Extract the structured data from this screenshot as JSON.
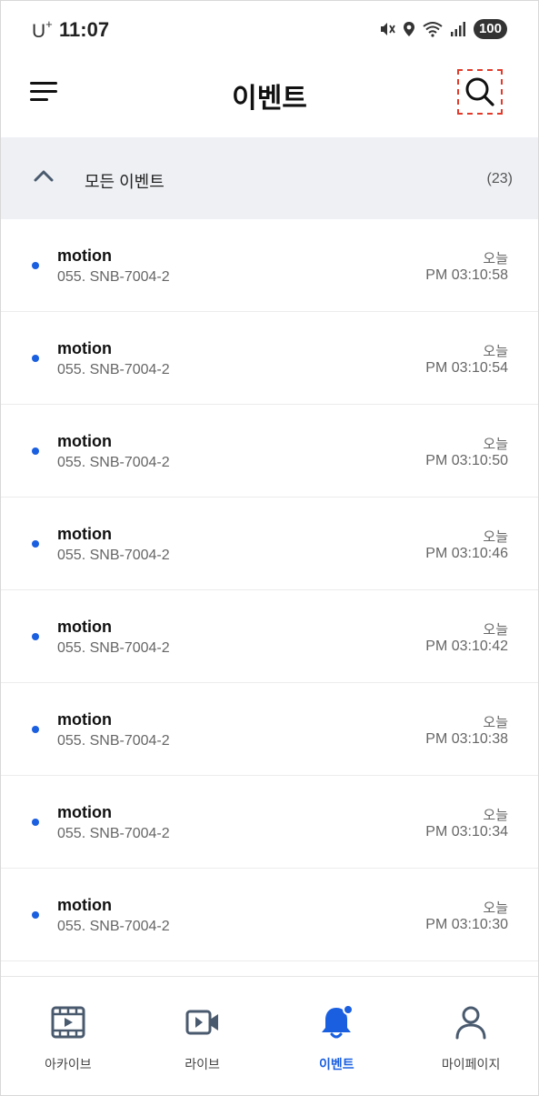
{
  "status_bar": {
    "carrier": "U",
    "carrier_sup": "+",
    "time": "11:07",
    "battery": "100"
  },
  "header": {
    "title": "이벤트",
    "menu_icon": "menu-icon",
    "search_icon": "search-icon"
  },
  "group": {
    "title": "모든 이벤트",
    "count": "(23)",
    "expanded": true
  },
  "events": [
    {
      "title": "motion",
      "camera": "055. SNB-7004-2",
      "day": "오늘",
      "time": "PM 03:10:58"
    },
    {
      "title": "motion",
      "camera": "055. SNB-7004-2",
      "day": "오늘",
      "time": "PM 03:10:54"
    },
    {
      "title": "motion",
      "camera": "055. SNB-7004-2",
      "day": "오늘",
      "time": "PM 03:10:50"
    },
    {
      "title": "motion",
      "camera": "055. SNB-7004-2",
      "day": "오늘",
      "time": "PM 03:10:46"
    },
    {
      "title": "motion",
      "camera": "055. SNB-7004-2",
      "day": "오늘",
      "time": "PM 03:10:42"
    },
    {
      "title": "motion",
      "camera": "055. SNB-7004-2",
      "day": "오늘",
      "time": "PM 03:10:38"
    },
    {
      "title": "motion",
      "camera": "055. SNB-7004-2",
      "day": "오늘",
      "time": "PM 03:10:34"
    },
    {
      "title": "motion",
      "camera": "055. SNB-7004-2",
      "day": "오늘",
      "time": "PM 03:10:30"
    }
  ],
  "bottom_nav": {
    "items": [
      {
        "label": "아카이브",
        "icon": "film-play-icon"
      },
      {
        "label": "라이브",
        "icon": "video-camera-icon"
      },
      {
        "label": "이벤트",
        "icon": "bell-icon",
        "active": true
      },
      {
        "label": "마이페이지",
        "icon": "user-icon"
      }
    ]
  },
  "colors": {
    "accent": "#1a5fe0",
    "group_bg": "#eef0f4",
    "icon_gray": "#4a5a6e"
  }
}
